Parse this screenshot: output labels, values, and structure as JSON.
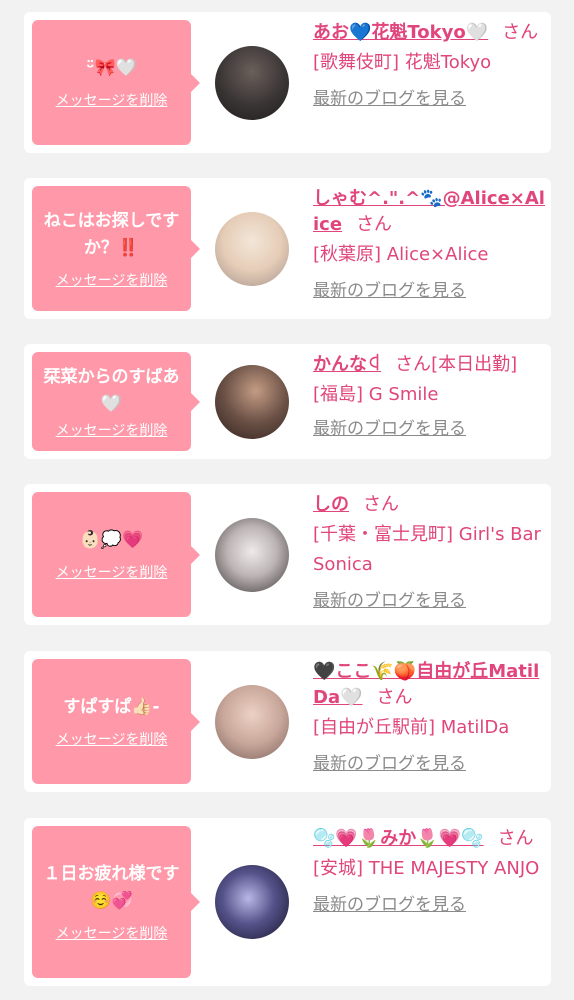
{
  "cards": [
    {
      "message": "ᵕ̈🎀🤍",
      "delete_label": "メッセージを削除",
      "name": "あお💙花魁Tokyo🤍",
      "honorific": "さん",
      "shop": "[歌舞伎町] 花魁Tokyo",
      "blog_label": "最新のブログを見る",
      "avatar_color": "#3a3535"
    },
    {
      "message": "ねこはお探しですか？‼️",
      "delete_label": "メッセージを削除",
      "name": "しゃむ^.\".^🐾@Alice×Alice",
      "honorific": "さん",
      "shop": "[秋葉原] Alice×Alice",
      "blog_label": "最新のブログを見る",
      "avatar_color": "#e9dcd0"
    },
    {
      "message": "栞菜からのすばあ🤍",
      "delete_label": "メッセージを削除",
      "name": "かんなꒉ",
      "honorific": "さん",
      "shop_inline": "[本日出勤]",
      "shop": "[福島] G Smile",
      "blog_label": "最新のブログを見る",
      "avatar_color": "#6b5146"
    },
    {
      "message": "👶🏻💭💗",
      "delete_label": "メッセージを削除",
      "name": "しの",
      "honorific": "さん",
      "shop": "[千葉・富士見町] Girl's Bar Sonica",
      "blog_label": "最新のブログを見る",
      "avatar_color": "#d8d3d3"
    },
    {
      "message": "すぱすぱ👍🏻-",
      "delete_label": "メッセージを削除",
      "name": "🖤ここ🌾🍑自由が丘MatilDa🤍",
      "honorific": "さん",
      "shop": "[自由が丘駅前] MatilDa",
      "blog_label": "最新のブログを見る",
      "avatar_color": "#c9a79b"
    },
    {
      "message": "１日お疲れ様です☺️💞",
      "delete_label": "メッセージを削除",
      "name": "🫧💗🌷みか🌷💗🫧",
      "honorific": "さん",
      "shop": "[安城] THE MAJESTY ANJO",
      "blog_label": "最新のブログを見る",
      "avatar_color": "#2c2b4a"
    }
  ]
}
